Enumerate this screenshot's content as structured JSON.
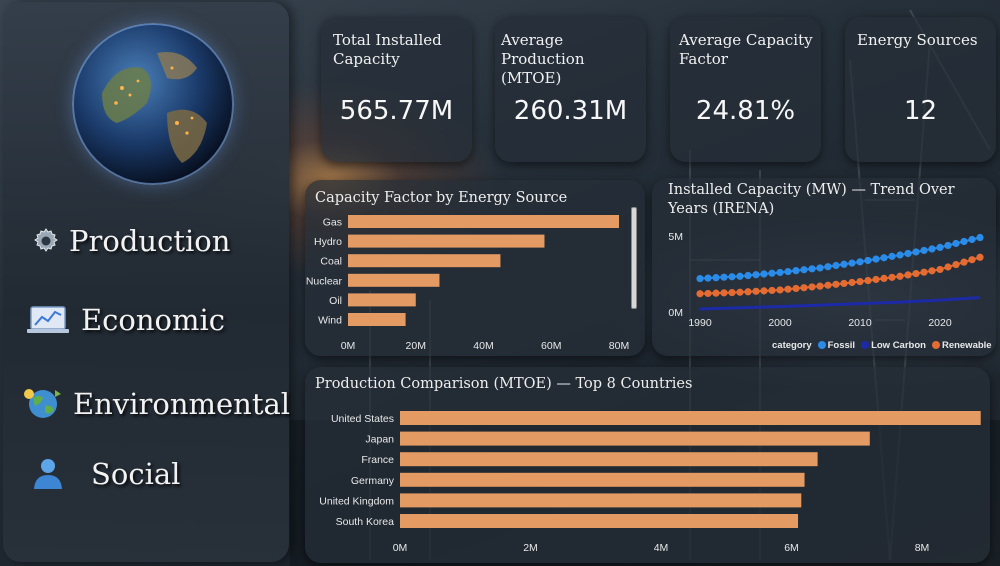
{
  "colors": {
    "bar": "#e39a63",
    "fossil": "#2b8be9",
    "low_carbon": "#1c2aa8",
    "renewable": "#e46b32"
  },
  "sidebar": {
    "items": [
      {
        "label": "Production",
        "icon": "gear-icon"
      },
      {
        "label": "Economic",
        "icon": "chart-icon"
      },
      {
        "label": "Environmental",
        "icon": "globe-icon"
      },
      {
        "label": "Social",
        "icon": "user-icon"
      }
    ]
  },
  "kpis": [
    {
      "title": "Total Installed Capacity",
      "value": "565.77M"
    },
    {
      "title": "Average Production (MTOE)",
      "value": "260.31M"
    },
    {
      "title": "Average Capacity Factor",
      "value": "24.81%"
    },
    {
      "title": "Energy Sources",
      "value": "12"
    }
  ],
  "chart_data": [
    {
      "type": "bar",
      "orientation": "horizontal",
      "title": "Capacity Factor by Energy Source",
      "categories": [
        "Gas",
        "Hydro",
        "Coal",
        "Nuclear",
        "Oil",
        "Wind"
      ],
      "values": [
        80,
        58,
        45,
        27,
        20,
        17
      ],
      "xticks": [
        "0M",
        "20M",
        "40M",
        "60M",
        "80M"
      ],
      "xlim": [
        0,
        80
      ],
      "scrollbar": true
    },
    {
      "type": "line",
      "title": "Installed Capacity (MW) — Trend Over Years (IRENA)",
      "yticks": [
        "5M",
        "0M"
      ],
      "xticks": [
        "1990",
        "2000",
        "2010",
        "2020"
      ],
      "ylim": [
        0,
        5
      ],
      "xlim": [
        1990,
        2025
      ],
      "legend_title": "category",
      "legend_position": "bottom-right",
      "series": [
        {
          "name": "Fossil",
          "markers": true,
          "x": [
            1990,
            1995,
            2000,
            2005,
            2010,
            2015,
            2020,
            2025
          ],
          "y": [
            2.2,
            2.35,
            2.6,
            2.9,
            3.3,
            3.75,
            4.25,
            4.9
          ]
        },
        {
          "name": "Low Carbon",
          "markers": false,
          "x": [
            1990,
            1995,
            2000,
            2005,
            2010,
            2015,
            2020,
            2025
          ],
          "y": [
            0.2,
            0.28,
            0.35,
            0.45,
            0.55,
            0.65,
            0.78,
            0.95
          ]
        },
        {
          "name": "Renewable",
          "markers": true,
          "x": [
            1990,
            1995,
            2000,
            2005,
            2010,
            2015,
            2020,
            2025
          ],
          "y": [
            1.2,
            1.3,
            1.45,
            1.7,
            2.0,
            2.35,
            2.8,
            3.6
          ]
        }
      ]
    },
    {
      "type": "bar",
      "orientation": "horizontal",
      "title": "Production Comparison (MTOE) — Top 8 Countries",
      "categories": [
        "United States",
        "Japan",
        "France",
        "Germany",
        "United Kingdom",
        "South Korea"
      ],
      "values": [
        8.9,
        7.2,
        6.4,
        6.2,
        6.15,
        6.1
      ],
      "xticks": [
        "0M",
        "2M",
        "4M",
        "6M",
        "8M"
      ],
      "xlim": [
        0,
        8
      ]
    }
  ]
}
